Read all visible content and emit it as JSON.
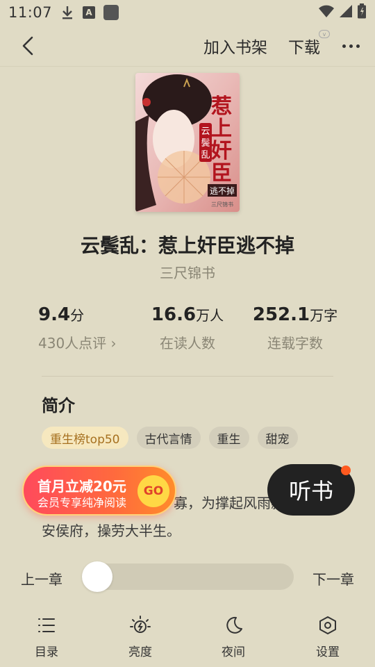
{
  "status_bar": {
    "time": "11:07",
    "icons": [
      "download-icon",
      "a-icon",
      "app-square-icon",
      "wifi-icon",
      "signal-icon",
      "battery-icon"
    ]
  },
  "top_bar": {
    "back_icon": "back-chevron-icon",
    "add_to_shelf": "加入书架",
    "download": "下载",
    "more_icon": "more-dots-icon"
  },
  "book": {
    "title": "云鬓乱：惹上奸臣逃不掉",
    "author": "三尺锦书",
    "cover_text": {
      "main": "惹上奸臣",
      "sub": "逃不掉",
      "series": "云鬓乱",
      "author": "三尺锦书"
    }
  },
  "stats": {
    "score": {
      "value": "9.4",
      "unit": "分",
      "label": "430人点评 ›"
    },
    "readers": {
      "value": "16.6",
      "unit": "万人",
      "label": "在读人数"
    },
    "words": {
      "value": "252.1",
      "unit": "万字",
      "label": "连载字数"
    }
  },
  "intro": {
    "title": "简介",
    "tags": [
      "重生榜top50",
      "古代言情",
      "重生",
      "甜宠"
    ],
    "synopsis_visible": "寡，为撑起风雨飘摇的靖",
    "synopsis_line2": "安侯府，操劳大半生。"
  },
  "promo": {
    "line1": "首月立减20元",
    "line2": "会员专享纯净阅读",
    "go": "GO"
  },
  "listen": {
    "label": "听书"
  },
  "chapter_nav": {
    "prev": "上一章",
    "next": "下一章",
    "progress": 0
  },
  "bottom_nav": [
    {
      "label": "目录",
      "icon": "list-icon"
    },
    {
      "label": "亮度",
      "icon": "brightness-icon"
    },
    {
      "label": "夜间",
      "icon": "moon-icon"
    },
    {
      "label": "设置",
      "icon": "settings-icon"
    }
  ],
  "colors": {
    "background": "#e0dbc5",
    "promo_gradient_start": "#ff4a5c",
    "promo_gradient_end": "#ff8c2b",
    "listen_button": "#222222",
    "listen_dot": "#ff5a1f",
    "hot_tag_bg": "#f6e8bf"
  }
}
